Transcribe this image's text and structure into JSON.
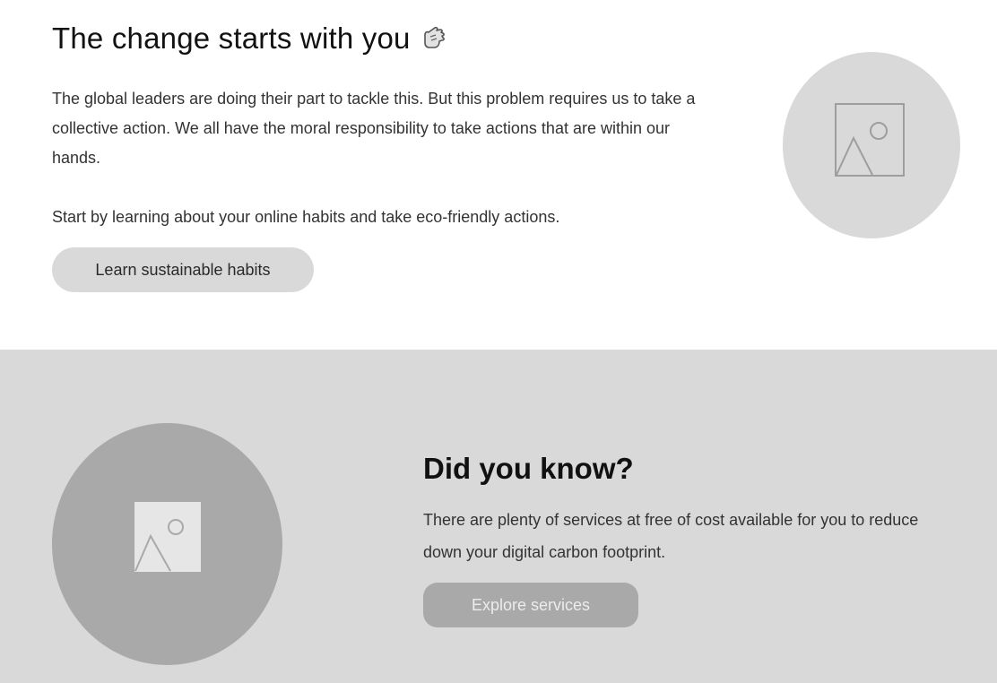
{
  "top_section": {
    "title": "The change starts with you",
    "title_icon": "pointing-hand-icon",
    "paragraph_1": "The global leaders are doing their part to tackle this. But this problem requires us to take a collective action. We all have the moral responsibility to take actions that are within our hands.",
    "paragraph_2": "Start by learning about your online habits and take eco-friendly actions.",
    "button_label": "Learn sustainable habits",
    "image_icon": "image-placeholder-icon"
  },
  "bottom_section": {
    "title": "Did you know?",
    "body": "There are plenty of services at free of cost available for you to reduce down your digital carbon footprint.",
    "button_label": "Explore services",
    "image_icon": "image-placeholder-icon"
  },
  "colors": {
    "background": "#ffffff",
    "section_gray": "#d9d9d9",
    "placeholder_dark": "#a9a9a9",
    "text_primary": "#111111",
    "text_body": "#333333"
  }
}
